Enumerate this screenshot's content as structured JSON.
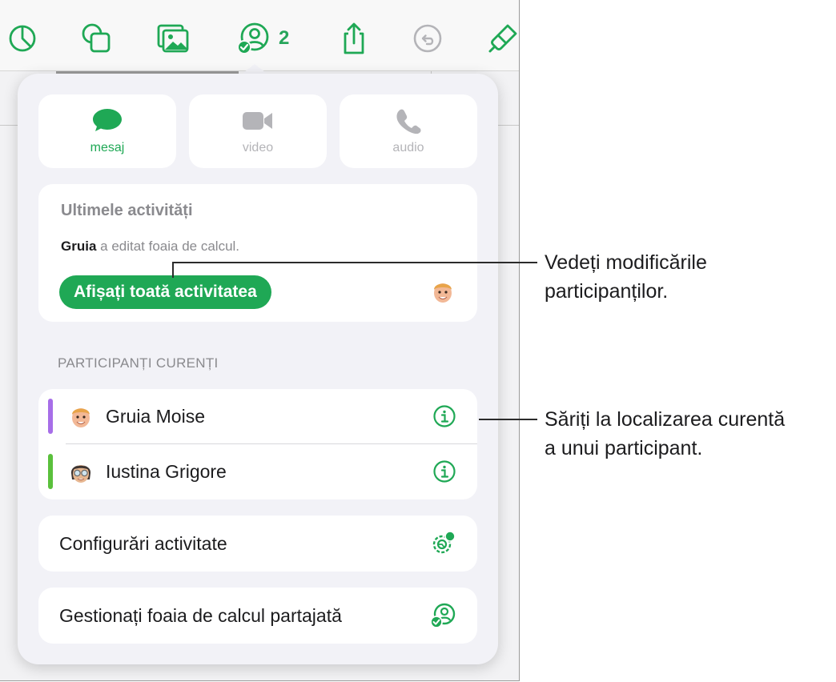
{
  "toolbar": {
    "collab_count": "2",
    "icons": [
      "chart-icon",
      "shapes-icon",
      "media-icon",
      "collaborate-icon",
      "share-icon",
      "undo-icon",
      "format-brush-icon"
    ]
  },
  "communication": {
    "message_label": "mesaj",
    "video_label": "video",
    "audio_label": "audio"
  },
  "activity": {
    "title": "Ultimele activități",
    "editor_name": "Gruia",
    "edit_text": "a editat foaia de calcul.",
    "show_all_label": "Afișați toată activitatea"
  },
  "participants": {
    "header": "PARTICIPANȚI CURENȚI",
    "items": [
      {
        "name": "Gruia Moise",
        "color": "#a76ee8"
      },
      {
        "name": "Iustina Grigore",
        "color": "#5ac03c"
      }
    ]
  },
  "settings": {
    "activity_settings_label": "Configurări activitate",
    "manage_label": "Gestionați foaia de calcul partajată"
  },
  "callouts": {
    "first_line1": "Vedeți modificările",
    "first_line2": "participanților.",
    "second_line1": "Săriți la localizarea curentă",
    "second_line2": "a unui participant."
  },
  "colors": {
    "accent": "#1fa855",
    "secondary_text": "#8a8a8e",
    "inactive_icon": "#b4b4b8"
  }
}
